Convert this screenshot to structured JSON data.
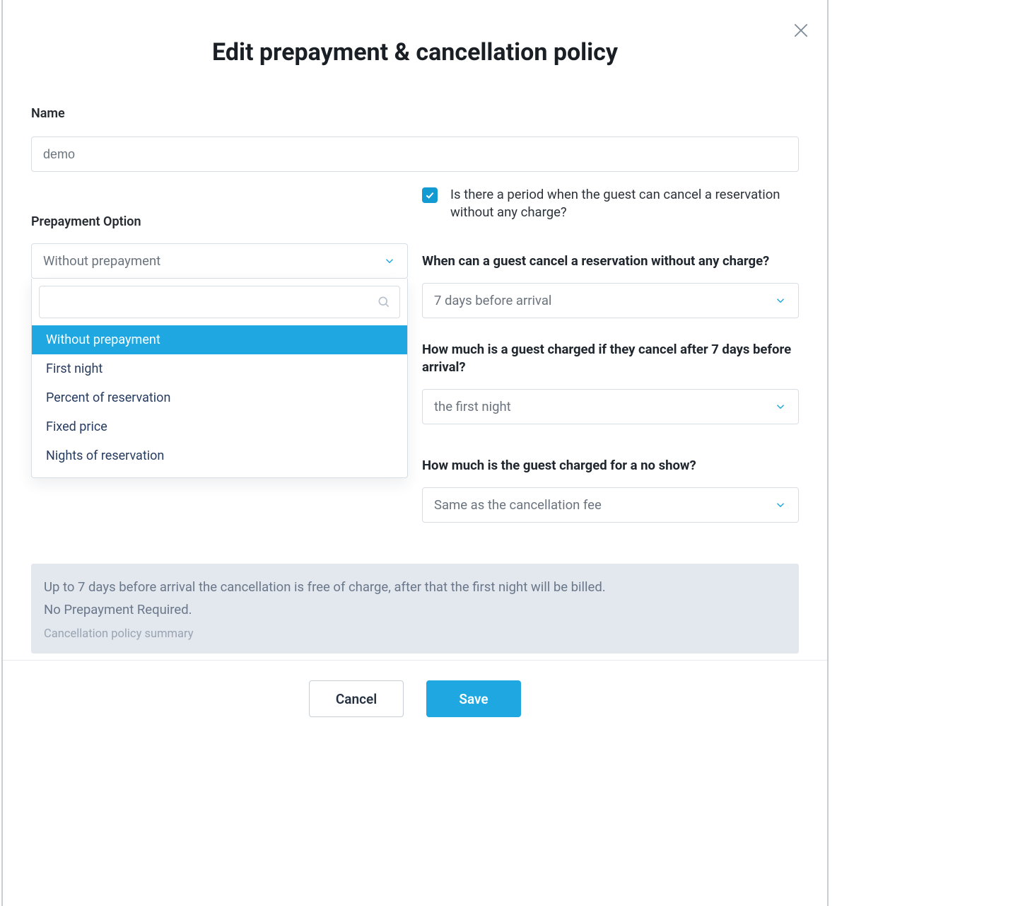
{
  "title": "Edit prepayment & cancellation policy",
  "name": {
    "label": "Name",
    "value": "demo"
  },
  "prepayment": {
    "label": "Prepayment Option",
    "selected": "Without prepayment",
    "search": "",
    "options": [
      "Without prepayment",
      "First night",
      "Percent of reservation",
      "Fixed price",
      "Nights of reservation"
    ]
  },
  "free_cancel": {
    "checkbox_label": "Is there a period when the guest can cancel a reservation without any charge?",
    "checked": true,
    "when": {
      "label": "When can a guest cancel a reservation without any charge?",
      "value": "7 days before arrival"
    },
    "late_fee": {
      "label": "How much is a guest charged if they cancel after 7 days before arrival?",
      "value": "the first night"
    },
    "no_show": {
      "label": "How much is the guest charged for a no show?",
      "value": "Same as the cancellation fee"
    }
  },
  "summary": {
    "line1": "Up to 7 days before arrival the cancellation is free of charge, after that the first night will be billed.",
    "line2": "No Prepayment Required.",
    "caption": "Cancellation policy summary"
  },
  "buttons": {
    "cancel": "Cancel",
    "save": "Save"
  }
}
